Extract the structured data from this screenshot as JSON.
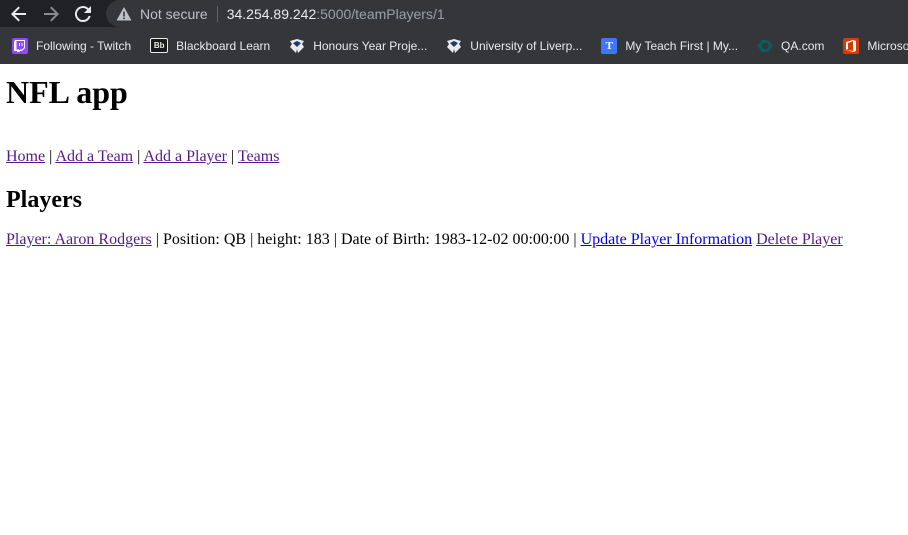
{
  "browser": {
    "not_secure_label": "Not secure",
    "url_host": "34.254.89.242",
    "url_rest": ":5000/teamPlayers/1",
    "bookmarks": [
      {
        "label": "Following - Twitch",
        "icon": "twitch-icon"
      },
      {
        "label": "Blackboard Learn",
        "icon": "blackboard-icon"
      },
      {
        "label": "Honours Year Proje...",
        "icon": "liverpool-crest-icon"
      },
      {
        "label": "University of Liverp...",
        "icon": "liverpool-crest-icon"
      },
      {
        "label": "My Teach First | My...",
        "icon": "teach-first-icon"
      },
      {
        "label": "QA.com",
        "icon": "qa-icon"
      },
      {
        "label": "Microsoft Off",
        "icon": "microsoft-office-icon"
      }
    ]
  },
  "page": {
    "title": "NFL app",
    "nav": {
      "home": "Home",
      "add_team": "Add a Team",
      "add_player": "Add a Player",
      "teams": "Teams",
      "separator": "|"
    },
    "section_title": "Players",
    "players": [
      {
        "name_link": "Player: Aaron Rodgers",
        "position": "Position: QB",
        "height": "height: 183",
        "dob": "Date of Birth: 1983-12-02 00:00:00",
        "update_label": "Update Player Information",
        "delete_label": "Delete Player"
      }
    ]
  }
}
